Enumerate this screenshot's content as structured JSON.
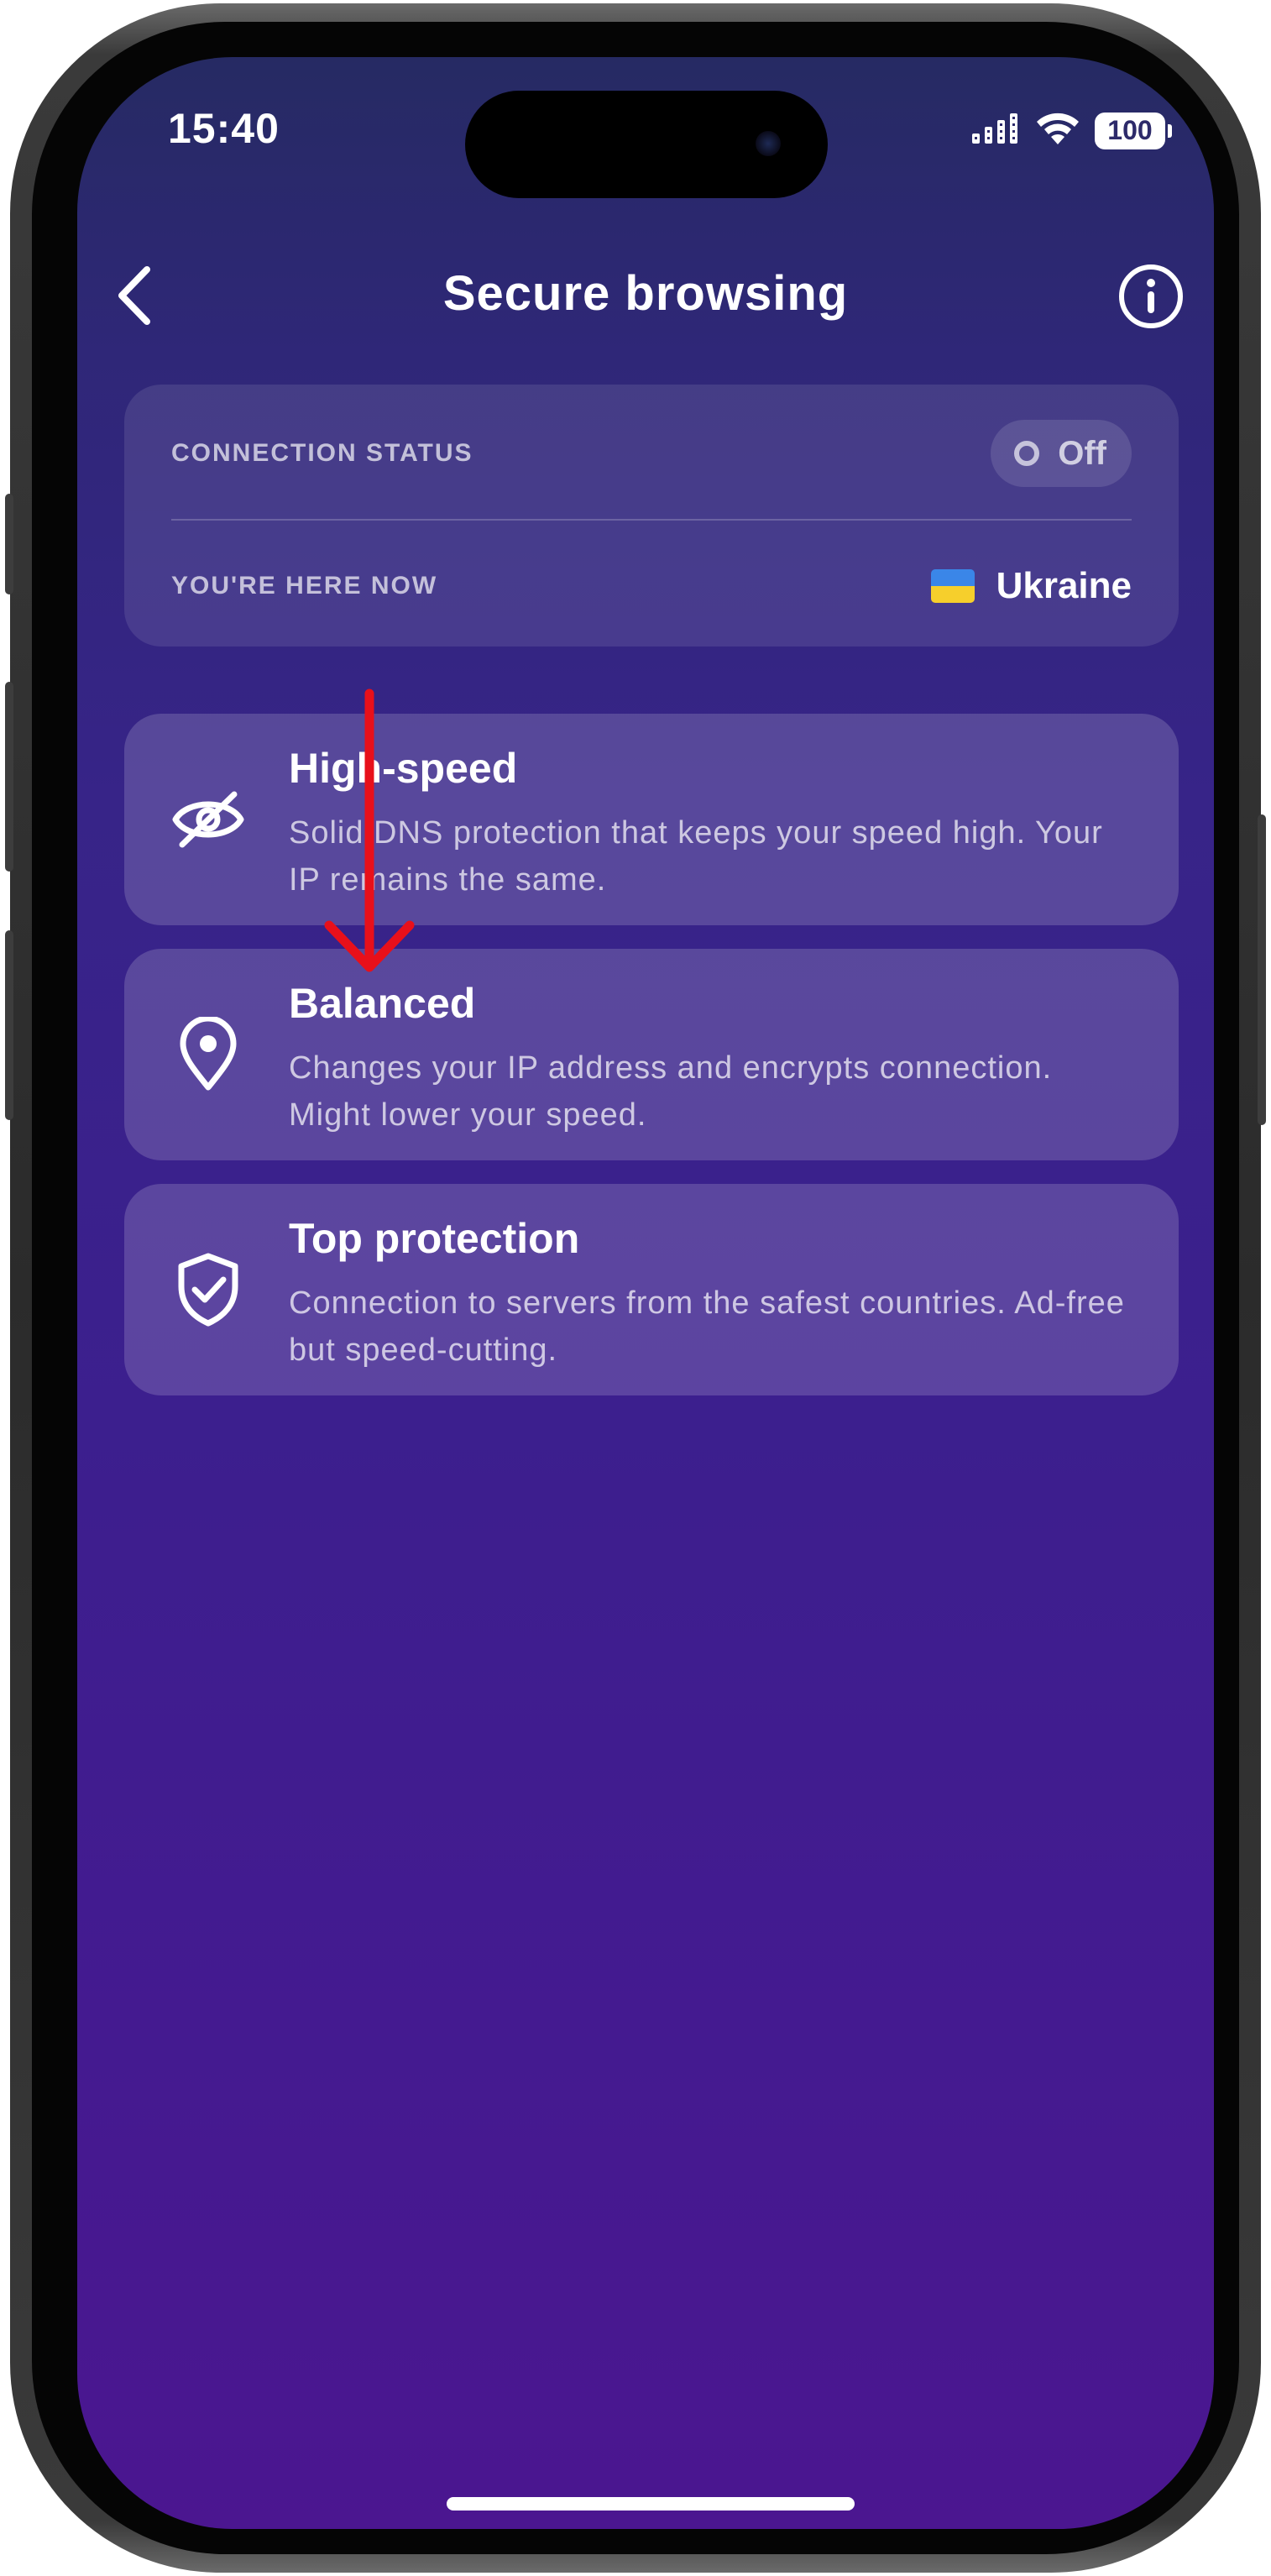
{
  "status_bar": {
    "time": "15:40",
    "battery": "100",
    "icons": [
      "signal-icon",
      "wifi-icon",
      "battery-icon"
    ]
  },
  "header": {
    "title": "Secure browsing",
    "back_icon": "chevron-left-icon",
    "info_icon": "info-icon"
  },
  "connection": {
    "status_label": "CONNECTION STATUS",
    "status_value": "Off",
    "location_label": "YOU'RE HERE NOW",
    "country": "Ukraine"
  },
  "modes": [
    {
      "title": "High-speed",
      "description": "Solid DNS protection that keeps your speed high. Your IP remains the same.",
      "icon": "eye-off-icon"
    },
    {
      "title": "Balanced",
      "description": "Changes your IP address and encrypts connection. Might lower your speed.",
      "icon": "location-pin-icon"
    },
    {
      "title": "Top protection",
      "description": "Connection to servers from the safest countries. Ad-free but speed-cutting.",
      "icon": "shield-check-icon"
    }
  ],
  "colors": {
    "background_top": "#262a63",
    "background_bottom": "#4b1690",
    "annotation_arrow": "#e8101a",
    "flag_blue": "#3a86e8",
    "flag_yellow": "#f6cf2c"
  }
}
